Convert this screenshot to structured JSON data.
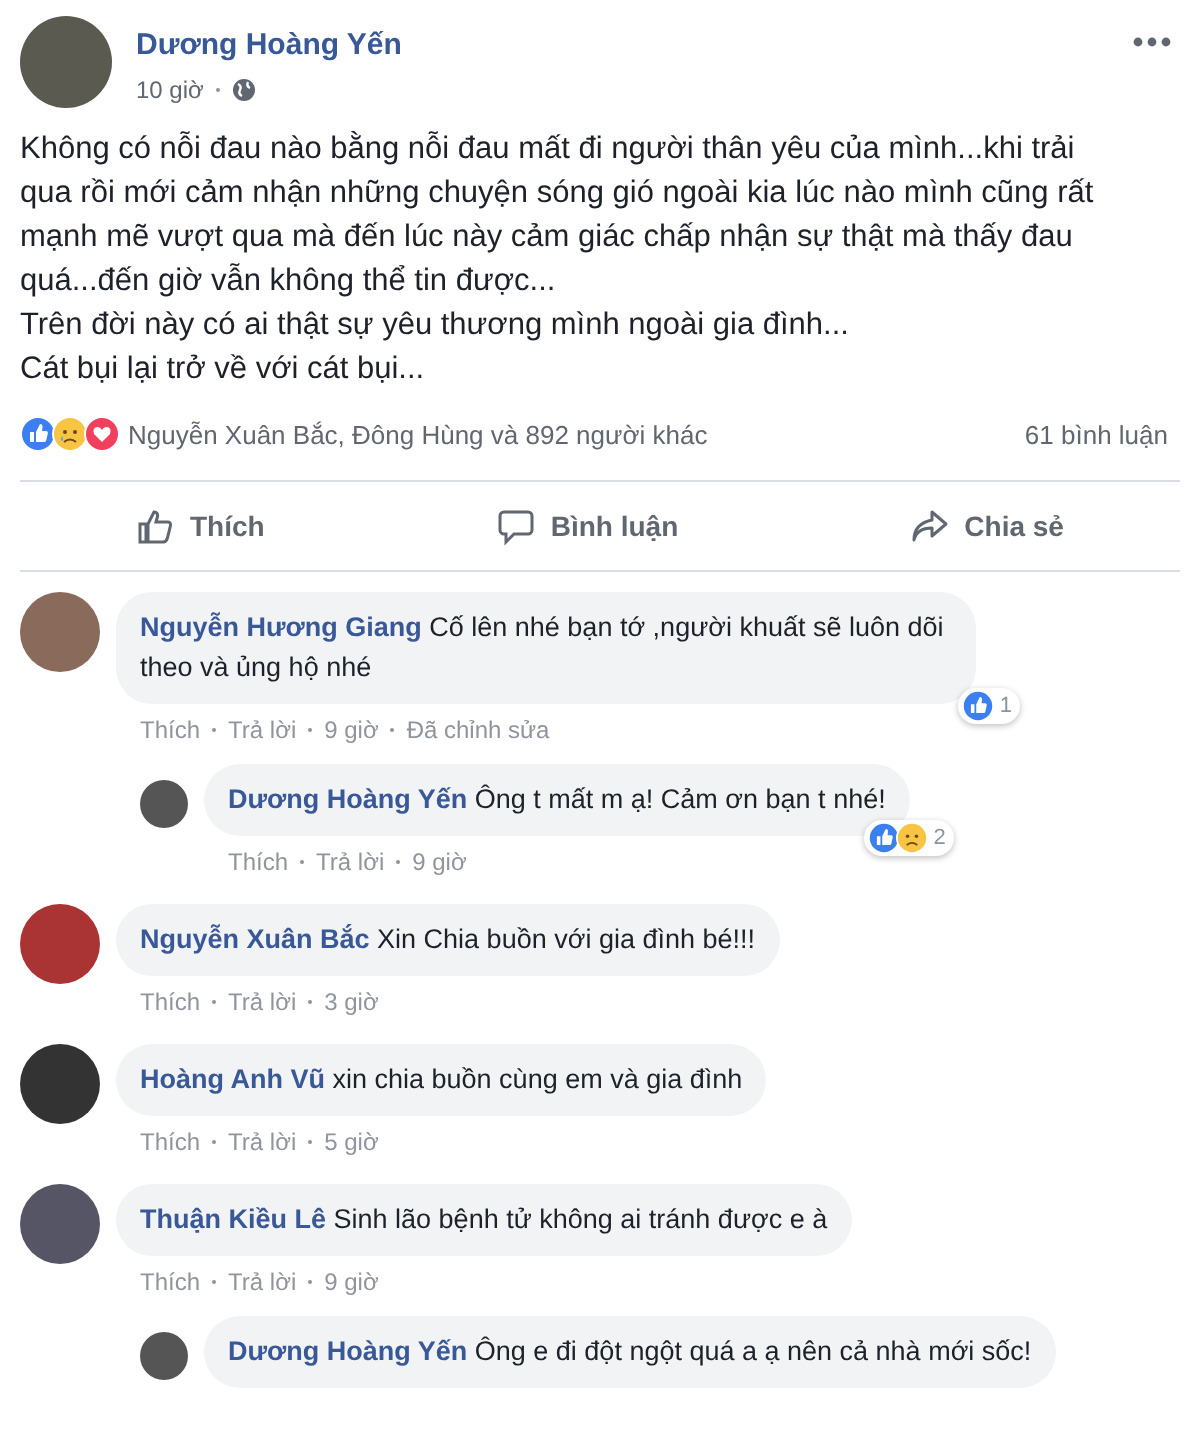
{
  "post": {
    "author": "Dương Hoàng Yến",
    "time": "10 giờ",
    "paragraphs": [
      "Không có nỗi đau nào bằng nỗi đau mất đi người thân yêu của mình...khi trải qua rồi mới cảm nhận những chuyện sóng gió ngoài kia lúc nào mình cũng rất mạnh mẽ vượt qua mà đến lúc này cảm giác chấp nhận sự thật mà thấy đau quá...đến giờ vẫn không thể tin được...",
      "Trên đời này có ai thật sự yêu thương mình ngoài gia đình...",
      "Cát bụi lại trở về với cát bụi..."
    ],
    "reactions": [
      {
        "kind": "like"
      },
      {
        "kind": "sad"
      },
      {
        "kind": "love"
      }
    ],
    "reaction_summary": "Nguyễn Xuân Bắc, Đông Hùng và 892 người khác",
    "comment_count": "61 bình luận",
    "actions": [
      {
        "kind": "like",
        "label": "Thích"
      },
      {
        "kind": "comment",
        "label": "Bình luận"
      },
      {
        "kind": "share",
        "label": "Chia sẻ"
      }
    ]
  },
  "comments": [
    {
      "name": "Nguyễn Hương Giang",
      "text": "Cố lên nhé bạn tớ ,người khuất sẽ luôn dõi theo và ủng hộ nhé",
      "links": [
        "Thích",
        "Trả lời",
        "9 giờ",
        "Đã chỉnh sửa"
      ],
      "reactions": [
        {
          "kind": "like"
        }
      ],
      "reaction_count": "1",
      "children": [
        {
          "name": "Dương Hoàng Yến",
          "text": "Ông t mất m ạ! Cảm ơn bạn t nhé!",
          "links": [
            "Thích",
            "Trả lời",
            "9 giờ"
          ],
          "reactions": [
            {
              "kind": "like"
            },
            {
              "kind": "sad"
            }
          ],
          "reaction_count": "2"
        }
      ]
    },
    {
      "name": "Nguyễn Xuân Bắc",
      "text": "Xin Chia buồn với gia đình bé!!!",
      "links": [
        "Thích",
        "Trả lời",
        "3 giờ"
      ]
    },
    {
      "name": "Hoàng Anh Vũ",
      "text": "xin chia buồn cùng em và gia đình",
      "links": [
        "Thích",
        "Trả lời",
        "5 giờ"
      ]
    },
    {
      "name": "Thuận Kiều Lê",
      "text": "Sinh lão bệnh tử không ai tránh được e à",
      "links": [
        "Thích",
        "Trả lời",
        "9 giờ"
      ],
      "children": [
        {
          "name": "Dương Hoàng Yến",
          "text": "Ông e đi đột ngột quá a ạ nên cả nhà mới sốc!"
        }
      ]
    }
  ]
}
